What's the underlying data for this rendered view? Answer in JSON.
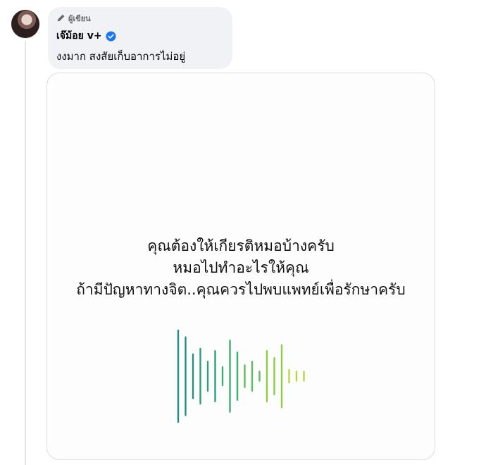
{
  "comment": {
    "badge_label": "ผู้เขียน",
    "author_name": "เจ๊ม้อย v+",
    "verified": true,
    "text": "งงมาก สงสัยเก็บอาการไม่อยู่"
  },
  "media": {
    "caption_lines": [
      "คุณต้องให้เกียรติหมอบ้างครับ",
      "หมอไปทำอะไรให้คุณ",
      "ถ้ามีปัญหาทางจิต..คุณควรไปพบแพทย์เพื่อรักษาครับ"
    ],
    "waveform_levels": [
      1.0,
      0.85,
      0.48,
      0.6,
      0.32,
      0.55,
      0.2,
      0.78,
      0.52,
      0.24,
      0.32,
      0.1,
      0.55,
      0.4,
      0.68,
      0.14,
      0.1,
      0.1
    ],
    "waveform_colors": [
      "#1f8f8a",
      "#2aa07e",
      "#3db06e",
      "#5cc05a",
      "#8bcd43",
      "#b9d83a"
    ]
  },
  "colors": {
    "verified_blue": "#1877f2",
    "bubble_bg": "#f0f2f5",
    "muted_text": "#65676b"
  }
}
